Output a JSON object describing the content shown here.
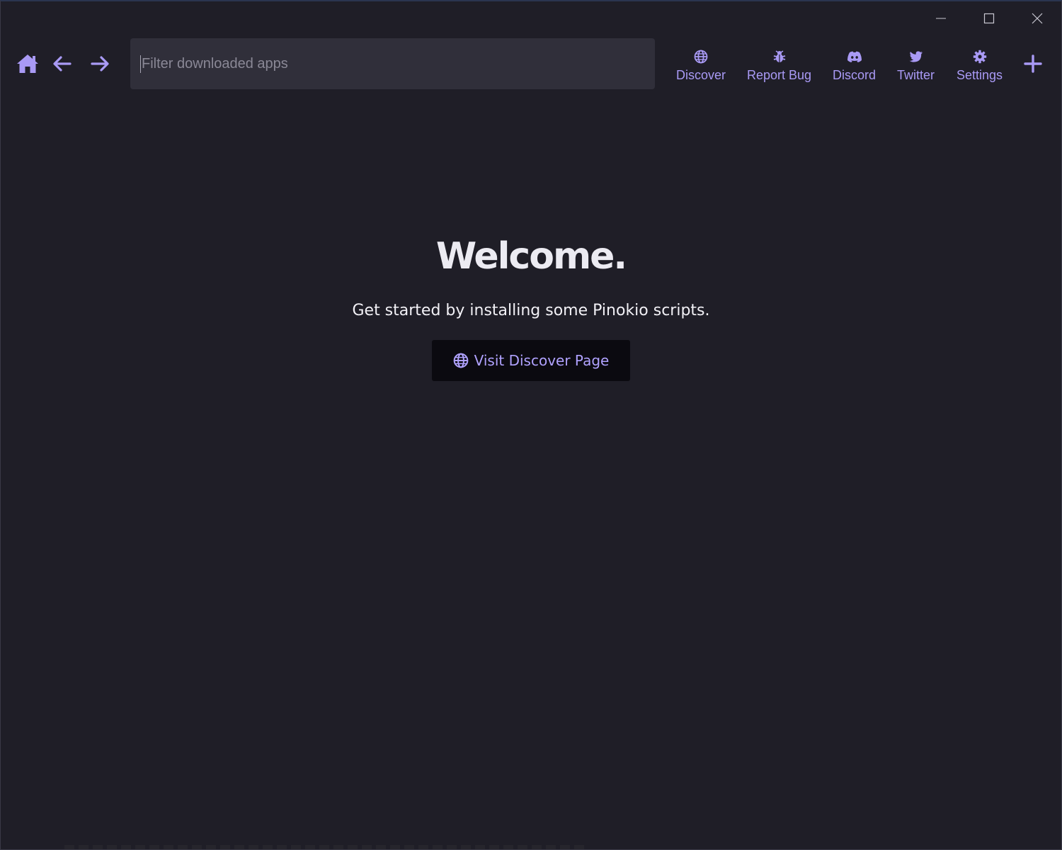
{
  "window": {
    "controls": [
      "minimize",
      "maximize",
      "close"
    ]
  },
  "nav": {
    "home_icon": "home-icon",
    "back_icon": "arrow-left-icon",
    "forward_icon": "arrow-right-icon"
  },
  "search": {
    "value": "",
    "placeholder": "Filter downloaded apps"
  },
  "links": [
    {
      "label": "Discover",
      "icon": "globe-icon"
    },
    {
      "label": "Report Bug",
      "icon": "bug-icon"
    },
    {
      "label": "Discord",
      "icon": "discord-icon"
    },
    {
      "label": "Twitter",
      "icon": "twitter-icon"
    },
    {
      "label": "Settings",
      "icon": "gear-icon"
    }
  ],
  "main": {
    "title": "Welcome.",
    "subtitle": "Get started by installing some Pinokio scripts.",
    "discover_button_label": "Visit Discover Page"
  },
  "colors": {
    "background": "#1f1e27",
    "accent": "#a99af5",
    "search_bg": "#302f3a",
    "button_bg": "#0b0a10"
  }
}
